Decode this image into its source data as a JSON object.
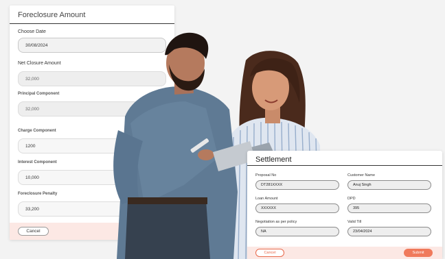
{
  "foreclosure": {
    "title": "Foreclosure Amount",
    "choose_date_label": "Choose Date",
    "date_value": "30/08/2024",
    "net_closure_label": "Net Closure Amount",
    "net_closure_value": "32,000",
    "principal_label": "Principal Component",
    "principal_value": "32,000",
    "charge_label": "Charge Component",
    "charge_value": "1200",
    "interest_label": "Interest Component",
    "interest_value": "10,000",
    "penalty_label": "Foreclosure Penalty",
    "penalty_value": "33,200",
    "cancel_label": "Cancel"
  },
  "settlement": {
    "title": "Settlement",
    "proposal_label": "Proposal No",
    "proposal_value": "DT281XXXX",
    "customer_label": "Customer Name",
    "customer_value": "Anuj Singh",
    "loan_label": "Loan Amount",
    "loan_value": "XXXXXX",
    "dpd_label": "DPD",
    "dpd_value": "395",
    "negotiation_label": "Negotiation as per policy",
    "negotiation_value": "NA",
    "valid_till_label": "Valid Till",
    "valid_till_value": "23/04/2024",
    "cancel_label": "Cancel",
    "submit_label": "Submit"
  },
  "colors": {
    "accent": "#f07a5c",
    "footer_bg": "#fce8e4",
    "card_bg": "#ffffff"
  }
}
